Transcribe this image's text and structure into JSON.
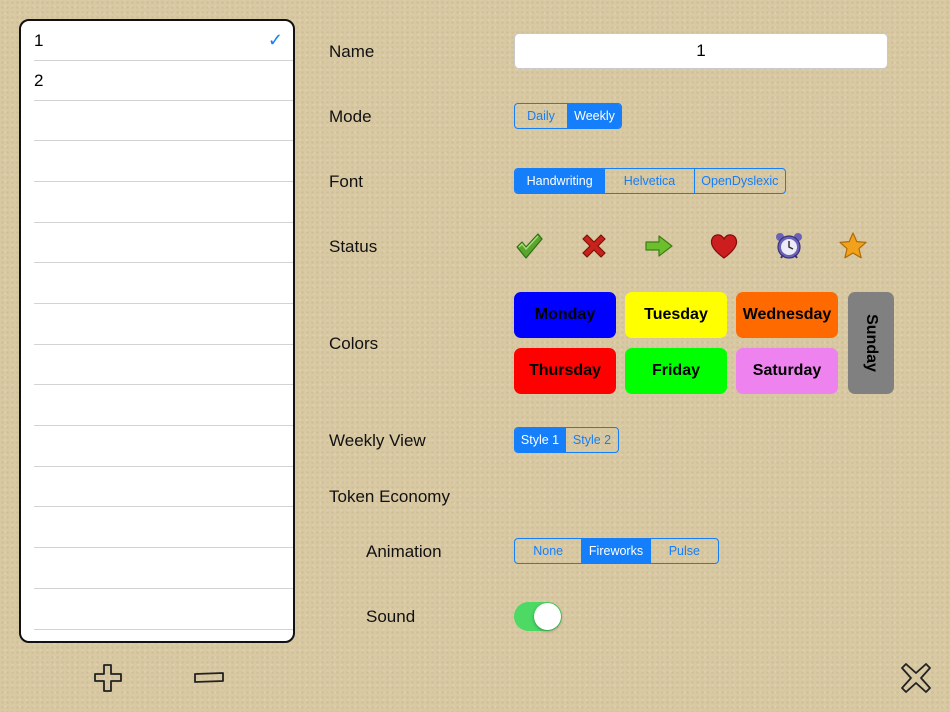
{
  "list": {
    "rows": [
      {
        "label": "1",
        "selected": true
      },
      {
        "label": "2",
        "selected": false
      },
      {
        "label": "",
        "selected": false
      },
      {
        "label": "",
        "selected": false
      },
      {
        "label": "",
        "selected": false
      },
      {
        "label": "",
        "selected": false
      },
      {
        "label": "",
        "selected": false
      },
      {
        "label": "",
        "selected": false
      },
      {
        "label": "",
        "selected": false
      },
      {
        "label": "",
        "selected": false
      },
      {
        "label": "",
        "selected": false
      },
      {
        "label": "",
        "selected": false
      },
      {
        "label": "",
        "selected": false
      },
      {
        "label": "",
        "selected": false
      },
      {
        "label": "",
        "selected": false
      }
    ],
    "check_mark": "✓"
  },
  "form": {
    "name_label": "Name",
    "name_value": "1",
    "mode_label": "Mode",
    "mode_options": [
      "Daily",
      "Weekly"
    ],
    "mode_selected": "Weekly",
    "font_label": "Font",
    "font_options": [
      "Handwriting",
      "Helvetica",
      "OpenDyslexic"
    ],
    "font_selected": "Handwriting",
    "status_label": "Status",
    "status_icons": [
      "check-icon",
      "cross-icon",
      "arrow-right-icon",
      "heart-icon",
      "alarm-clock-icon",
      "star-icon"
    ],
    "colors_label": "Colors",
    "days": [
      {
        "name": "Monday",
        "color": "#0000ff"
      },
      {
        "name": "Tuesday",
        "color": "#ffff00"
      },
      {
        "name": "Wednesday",
        "color": "#ff6a00"
      },
      {
        "name": "Thursday",
        "color": "#ff0000"
      },
      {
        "name": "Friday",
        "color": "#00ff00"
      },
      {
        "name": "Saturday",
        "color": "#ee82ee"
      },
      {
        "name": "Sunday",
        "color": "#808080"
      }
    ],
    "weekly_view_label": "Weekly View",
    "weekly_view_options": [
      "Style 1",
      "Style 2"
    ],
    "weekly_view_selected": "Style 1",
    "token_economy_label": "Token Economy",
    "animation_label": "Animation",
    "animation_options": [
      "None",
      "Fireworks",
      "Pulse"
    ],
    "animation_selected": "Fireworks",
    "sound_label": "Sound",
    "sound_on": true
  },
  "colors": {
    "accent": "#147efb",
    "toggle_on": "#4cd964"
  },
  "toolbar": {
    "add_icon": "plus-icon",
    "remove_icon": "minus-icon",
    "close_icon": "close-icon"
  }
}
